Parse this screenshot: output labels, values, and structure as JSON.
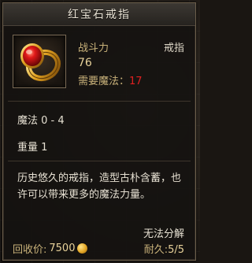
{
  "tooltip": {
    "title": "红宝石戒指",
    "power_label": "战斗力",
    "power_value": "76",
    "type": "戒指",
    "requirement_label": "需要魔法：",
    "requirement_value": "17",
    "requirement_value_color": "#e02020",
    "stats": [
      "魔法 0 - 4",
      "重量 1"
    ],
    "description": "历史悠久的戒指，造型古朴含蓄，也许可以带来更多的魔法力量。",
    "decompose_status": "无法分解",
    "price_label": "回收价:",
    "price_value": "7500",
    "durability_label": "耐久:",
    "durability_value": "5/5",
    "item_icon": "ruby-ring-icon",
    "currency_icon": "gold-coin-icon"
  }
}
